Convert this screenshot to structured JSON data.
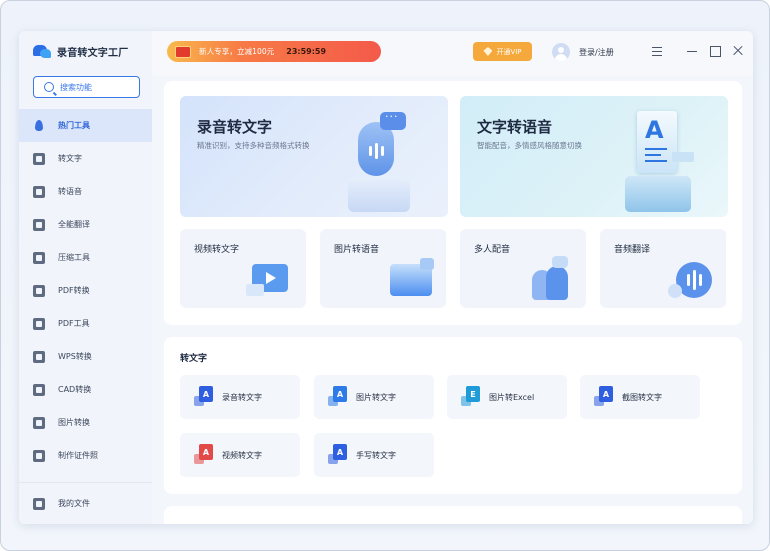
{
  "app": {
    "title": "录音转文字工厂"
  },
  "search": {
    "label": "搜索功能"
  },
  "sidebar": {
    "items": [
      {
        "label": "热门工具",
        "icon": "fire-icon",
        "active": true
      },
      {
        "label": "转文字",
        "icon": "text-icon"
      },
      {
        "label": "转语音",
        "icon": "voice-icon"
      },
      {
        "label": "全能翻译",
        "icon": "translate-icon"
      },
      {
        "label": "压缩工具",
        "icon": "compress-icon"
      },
      {
        "label": "PDF转换",
        "icon": "pdf-convert-icon"
      },
      {
        "label": "PDF工具",
        "icon": "pdf-tools-icon"
      },
      {
        "label": "WPS转换",
        "icon": "wps-icon"
      },
      {
        "label": "CAD转换",
        "icon": "cad-icon"
      },
      {
        "label": "图片转换",
        "icon": "image-icon"
      },
      {
        "label": "制作证件照",
        "icon": "id-photo-icon"
      }
    ],
    "my_files": "我的文件"
  },
  "topbar": {
    "promo_text": "新人专享，立减100元",
    "promo_timer": "23:59:59",
    "vip_label": "开通VIP",
    "login_label": "登录/注册"
  },
  "hero": {
    "left": {
      "title": "录音转文字",
      "subtitle": "精准识别，支持多种音频格式转换"
    },
    "right": {
      "title": "文字转语音",
      "subtitle": "智能配音，多情感风格随意切换"
    }
  },
  "features": [
    {
      "label": "视频转文字",
      "icon": "video-to-text-icon"
    },
    {
      "label": "图片转语音",
      "icon": "image-to-voice-icon"
    },
    {
      "label": "多人配音",
      "icon": "multi-voice-icon"
    },
    {
      "label": "音频翻译",
      "icon": "audio-translate-icon"
    }
  ],
  "section": {
    "title": "转文字",
    "tools": [
      {
        "label": "录音转文字",
        "badge": "A",
        "color": "#2e5fe0"
      },
      {
        "label": "图片转文字",
        "badge": "A",
        "color": "#2e7ae8"
      },
      {
        "label": "图片转Excel",
        "badge": "E",
        "color": "#1f9bd8"
      },
      {
        "label": "截图转文字",
        "badge": "A",
        "color": "#2e5fe0"
      },
      {
        "label": "视频转文字",
        "badge": "A",
        "color": "#e24a4a"
      },
      {
        "label": "手写转文字",
        "badge": "A",
        "color": "#2e5fe0"
      }
    ]
  },
  "colors": {
    "accent": "#3a78e8",
    "promo": "#f45a4a",
    "vip": "#f5a83b"
  }
}
